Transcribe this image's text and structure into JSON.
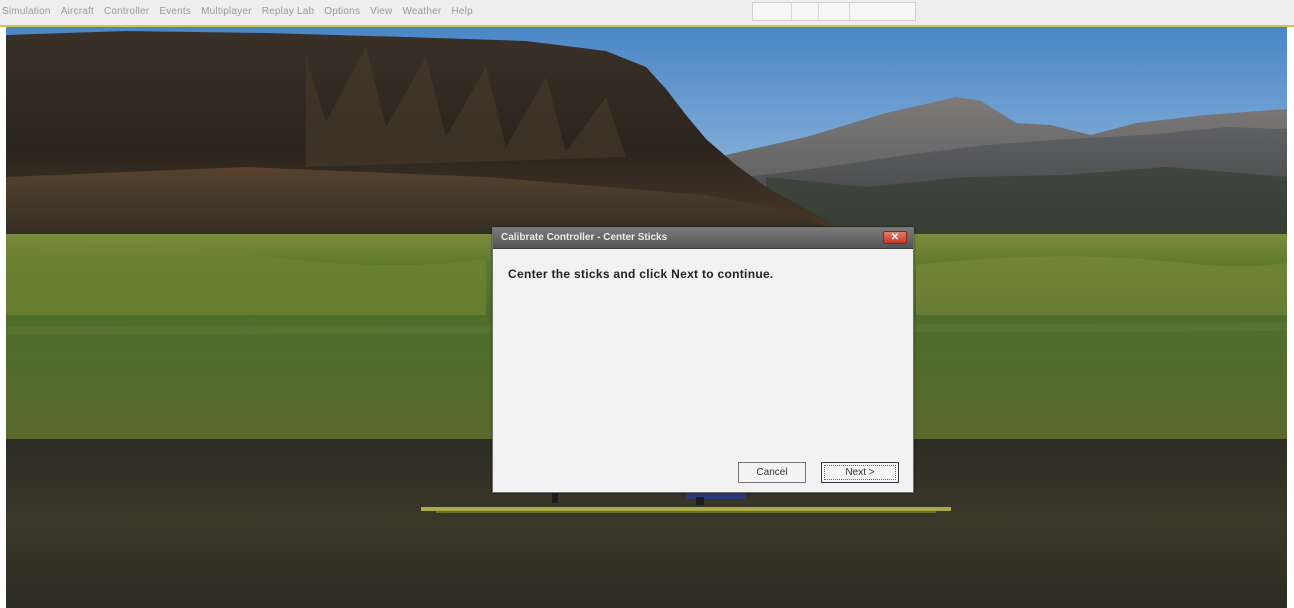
{
  "menu": {
    "items": [
      "Simulation",
      "Aircraft",
      "Controller",
      "Events",
      "Multiplayer",
      "Replay Lab",
      "Options",
      "View",
      "Weather",
      "Help"
    ]
  },
  "dialog": {
    "title": "Calibrate Controller - Center Sticks",
    "close_icon": "close-icon",
    "message": "Center the sticks and click Next to continue.",
    "cancel_label": "Cancel",
    "next_label": "Next >"
  },
  "colors": {
    "titlebar": "#5e5e5e",
    "close_button": "#d0503c",
    "menubar_accent": "#c8c84a",
    "dialog_body": "#f2f2f2"
  }
}
